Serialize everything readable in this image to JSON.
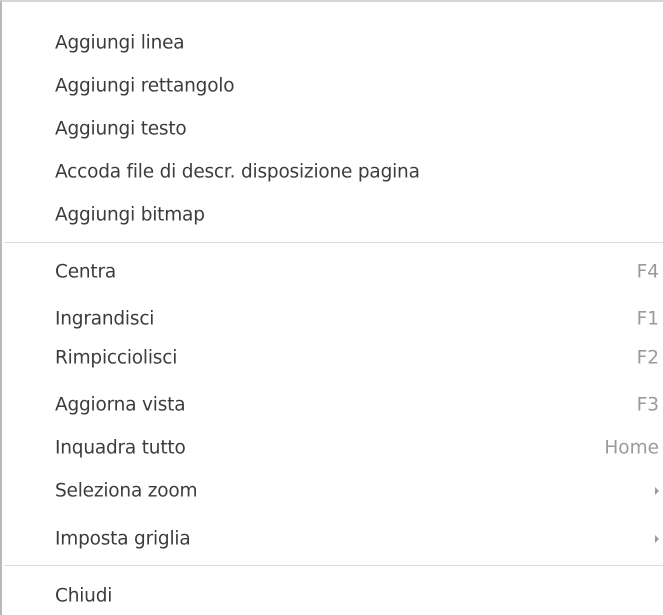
{
  "menu": {
    "groups": [
      {
        "items": [
          {
            "label": "Aggiungi linea"
          },
          {
            "label": "Aggiungi rettangolo"
          },
          {
            "label": "Aggiungi testo"
          },
          {
            "label": "Accoda file di descr. disposizione pagina"
          },
          {
            "label": "Aggiungi bitmap"
          }
        ]
      },
      {
        "items": [
          {
            "label": "Centra",
            "shortcut": "F4"
          },
          {
            "label": "Ingrandisci",
            "shortcut": "F1"
          },
          {
            "label": "Rimpicciolisci",
            "shortcut": "F2"
          },
          {
            "label": "Aggiorna vista",
            "shortcut": "F3"
          },
          {
            "label": "Inquadra tutto",
            "shortcut": "Home"
          },
          {
            "label": "Seleziona zoom",
            "submenu": true,
            "icon": "chevron-right-icon"
          },
          {
            "label": "Imposta griglia",
            "submenu": true,
            "icon": "chevron-right-icon"
          }
        ]
      },
      {
        "items": [
          {
            "label": "Chiudi"
          }
        ]
      }
    ]
  }
}
